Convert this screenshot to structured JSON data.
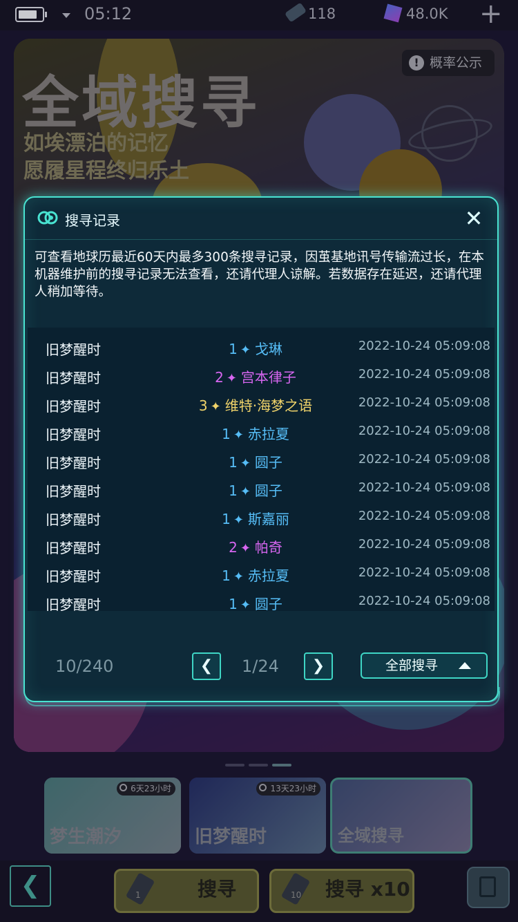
{
  "status_bar": {
    "time": "05:12",
    "tickets": "118",
    "crystals": "48.0K"
  },
  "banner": {
    "title": "全域搜寻",
    "subtitle_line1": "如埃漂泊的记忆",
    "subtitle_line2": "愿履星程终归乐土",
    "probability_label": "概率公示"
  },
  "modal": {
    "title": "搜寻记录",
    "close_label": "✕",
    "notice": "可查看地球历最近60天内最多300条搜寻记录，因茧基地讯号传输流过长，在本机器维护前的搜寻记录无法查看，还请代理人谅解。若数据存在延迟，还请代理人稍加等待。",
    "records": [
      {
        "pool": "旧梦醒时",
        "rarity": "1",
        "name": "戈琳",
        "time": "2022-10-24 05:09:08"
      },
      {
        "pool": "旧梦醒时",
        "rarity": "2",
        "name": "宫本律子",
        "time": "2022-10-24 05:09:08"
      },
      {
        "pool": "旧梦醒时",
        "rarity": "3",
        "name": "维特·海梦之语",
        "time": "2022-10-24 05:09:08"
      },
      {
        "pool": "旧梦醒时",
        "rarity": "1",
        "name": "赤拉夏",
        "time": "2022-10-24 05:09:08"
      },
      {
        "pool": "旧梦醒时",
        "rarity": "1",
        "name": "圆子",
        "time": "2022-10-24 05:09:08"
      },
      {
        "pool": "旧梦醒时",
        "rarity": "1",
        "name": "圆子",
        "time": "2022-10-24 05:09:08"
      },
      {
        "pool": "旧梦醒时",
        "rarity": "1",
        "name": "斯嘉丽",
        "time": "2022-10-24 05:09:08"
      },
      {
        "pool": "旧梦醒时",
        "rarity": "2",
        "name": "帕奇",
        "time": "2022-10-24 05:09:08"
      },
      {
        "pool": "旧梦醒时",
        "rarity": "1",
        "name": "赤拉夏",
        "time": "2022-10-24 05:09:08"
      },
      {
        "pool": "旧梦醒时",
        "rarity": "1",
        "name": "圆子",
        "time": "2022-10-24 05:09:08"
      }
    ],
    "record_count": "10/240",
    "prev_label": "❮",
    "next_label": "❯",
    "page_indicator": "1/24",
    "filter_label": "全部搜寻"
  },
  "pool_cards": [
    {
      "label": "梦生潮汐",
      "timer": "6天23小时"
    },
    {
      "label": "旧梦醒时",
      "timer": "13天23小时"
    },
    {
      "label": "全域搜寻",
      "timer": ""
    }
  ],
  "bottom": {
    "back_label": "❮",
    "search_one": "搜寻",
    "search_one_count": "1",
    "search_ten": "搜寻 x10",
    "search_ten_count": "10"
  },
  "colors": {
    "accent": "#49e3d1",
    "rarity_1": "#56bdf6",
    "rarity_2": "#d766f0",
    "rarity_3": "#f0d36a"
  },
  "icons": [
    "battery-icon",
    "ticket-icon",
    "crystal-icon",
    "add-icon",
    "alert-icon",
    "planet-icon",
    "logo-icon",
    "close-icon",
    "star-icon",
    "chevron-left-icon",
    "chevron-right-icon",
    "caret-up-icon",
    "clock-icon",
    "record-icon"
  ]
}
